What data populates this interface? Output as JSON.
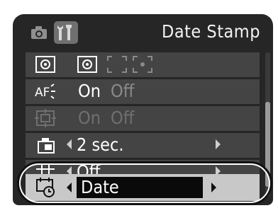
{
  "header": {
    "title": "Date Stamp",
    "tabs": [
      {
        "name": "camera-tab",
        "icon": "camera-icon",
        "selected": false
      },
      {
        "name": "setup-tab",
        "icon": "setup-tools-icon",
        "selected": true
      }
    ]
  },
  "menu": {
    "items": [
      {
        "icon": "metering-mode-icon",
        "options": [
          "evaluative",
          "center-weighted",
          "spot"
        ],
        "selected_option": "evaluative"
      },
      {
        "icon": "af-frame-icon",
        "options": [
          "On",
          "Off"
        ],
        "selected": "On"
      },
      {
        "icon": "digital-zoom-icon",
        "options": [
          "On",
          "Off"
        ],
        "selected": "On",
        "disabled": true
      },
      {
        "icon": "review-icon",
        "value": "2 sec."
      },
      {
        "icon": "grid-lines-icon",
        "value": "Off"
      },
      {
        "icon": "date-stamp-icon",
        "value": "Date",
        "selected": true
      }
    ]
  },
  "scroll": {
    "position": 0.7
  },
  "colors": {
    "lcd_background": "#262626",
    "row_background": "#444444",
    "selected_row": "#c8c8c8",
    "value_box": "#0a0a0a",
    "off_text": "#8a8a8a"
  }
}
